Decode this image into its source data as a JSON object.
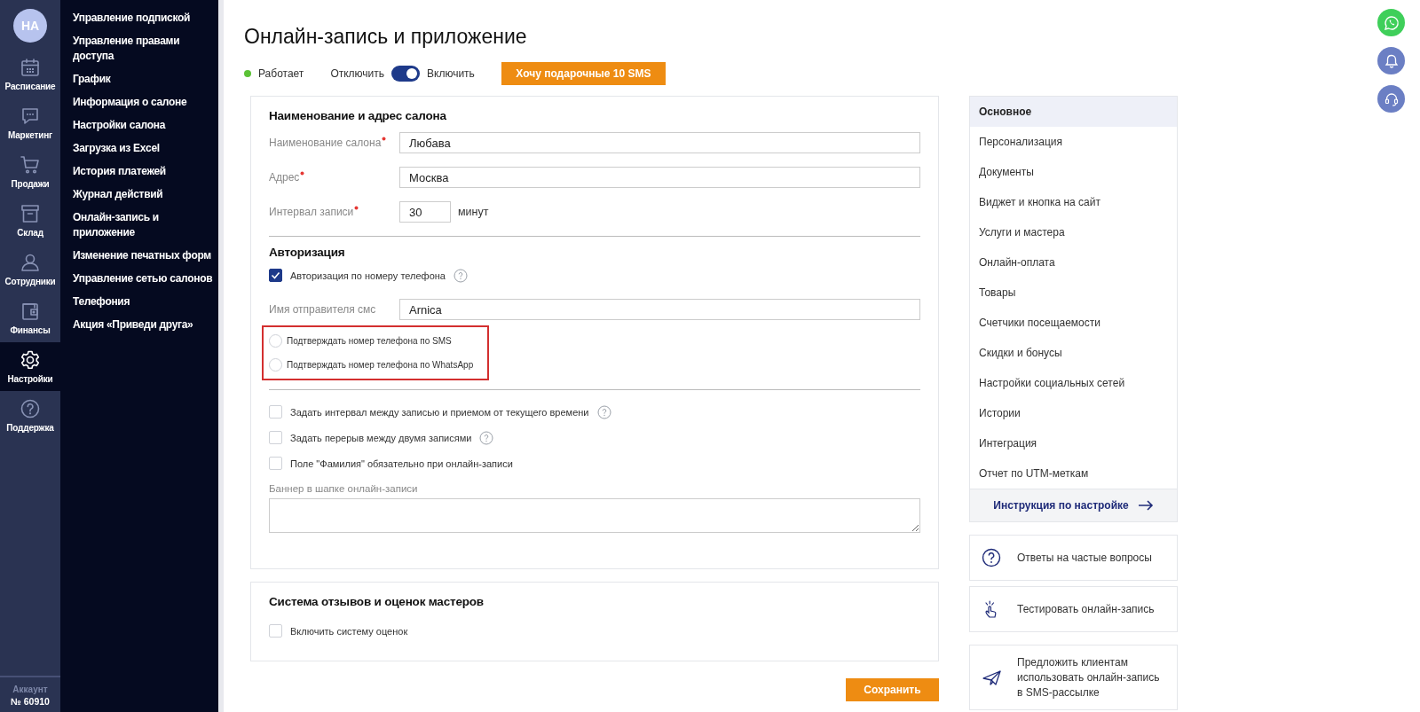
{
  "rail": {
    "avatar": "НА",
    "items": [
      {
        "label": "Расписание",
        "selected": false
      },
      {
        "label": "Маркетинг",
        "selected": false
      },
      {
        "label": "Продажи",
        "selected": false
      },
      {
        "label": "Склад",
        "selected": false
      },
      {
        "label": "Сотрудники",
        "selected": false
      },
      {
        "label": "Финансы",
        "selected": false
      },
      {
        "label": "Настройки",
        "selected": true
      },
      {
        "label": "Поддержка",
        "selected": false
      }
    ],
    "account_label": "Аккаунт",
    "account_number": "№ 60910"
  },
  "submenu": {
    "items": [
      "Управление подпиской",
      "Управление правами доступа",
      "График",
      "Информация о салоне",
      "Настройки салона",
      "Загрузка из Excel",
      "История платежей",
      "Журнал действий",
      "Онлайн-запись и приложение",
      "Изменение печатных форм",
      "Управление сетью салонов",
      "Телефония",
      "Акция «Приведи друга»"
    ]
  },
  "page": {
    "title": "Онлайн-запись и приложение",
    "status": "Работает",
    "toggle": {
      "off_label": "Отключить",
      "on_label": "Включить",
      "on": true
    },
    "promo_button": "Хочу подарочные 10 SMS"
  },
  "salon": {
    "heading": "Наименование и адрес салона",
    "fields": [
      {
        "label": "Наименование салона",
        "required": true,
        "value": "Любава"
      },
      {
        "label": "Адрес",
        "required": true,
        "value": "Москва"
      },
      {
        "label": "Интервал записи",
        "required": true,
        "value": "30",
        "unit": "минут"
      }
    ]
  },
  "authorization": {
    "heading": "Авторизация",
    "phone_auth": {
      "label": "Авторизация по номеру телефона",
      "checked": true,
      "help": true
    },
    "sender_field": {
      "label": "Имя отправителя смс",
      "value": "Arnica"
    },
    "highlight": true,
    "confirm_options": [
      {
        "label": "Подтверждать номер телефона по SMS",
        "selected": false
      },
      {
        "label": "Подтверждать номер телефона по WhatsApp",
        "selected": false
      }
    ]
  },
  "options": [
    {
      "label": "Задать интервал между записью и приемом от текущего времени",
      "checked": false,
      "help": true
    },
    {
      "label": "Задать перерыв между двумя записями",
      "checked": false,
      "help": true
    },
    {
      "label": "Поле \"Фамилия\" обязательно при онлайн-записи",
      "checked": false,
      "help": false
    }
  ],
  "banner": {
    "label": "Баннер в шапке онлайн-записи"
  },
  "reviews": {
    "heading": "Система отзывов и оценок мастеров",
    "option": {
      "label": "Включить систему оценок",
      "checked": false
    }
  },
  "save_button": "Сохранить",
  "settings_nav": {
    "items": [
      {
        "label": "Основное",
        "selected": true
      },
      {
        "label": "Персонализация",
        "selected": false
      },
      {
        "label": "Документы",
        "selected": false
      },
      {
        "label": "Виджет и кнопка на сайт",
        "selected": false
      },
      {
        "label": "Услуги и мастера",
        "selected": false
      },
      {
        "label": "Онлайн-оплата",
        "selected": false
      },
      {
        "label": "Товары",
        "selected": false
      },
      {
        "label": "Счетчики посещаемости",
        "selected": false
      },
      {
        "label": "Скидки и бонусы",
        "selected": false
      },
      {
        "label": "Настройки социальных сетей",
        "selected": false
      },
      {
        "label": "Истории",
        "selected": false
      },
      {
        "label": "Интеграция",
        "selected": false
      },
      {
        "label": "Отчет по UTM-меткам",
        "selected": false
      }
    ],
    "guide_link": "Инструкция по настройке"
  },
  "action_cards": [
    "Ответы на частые вопросы",
    "Тестировать онлайн-запись",
    "Предложить клиентам использовать онлайн-запись в SMS-рассылке"
  ]
}
